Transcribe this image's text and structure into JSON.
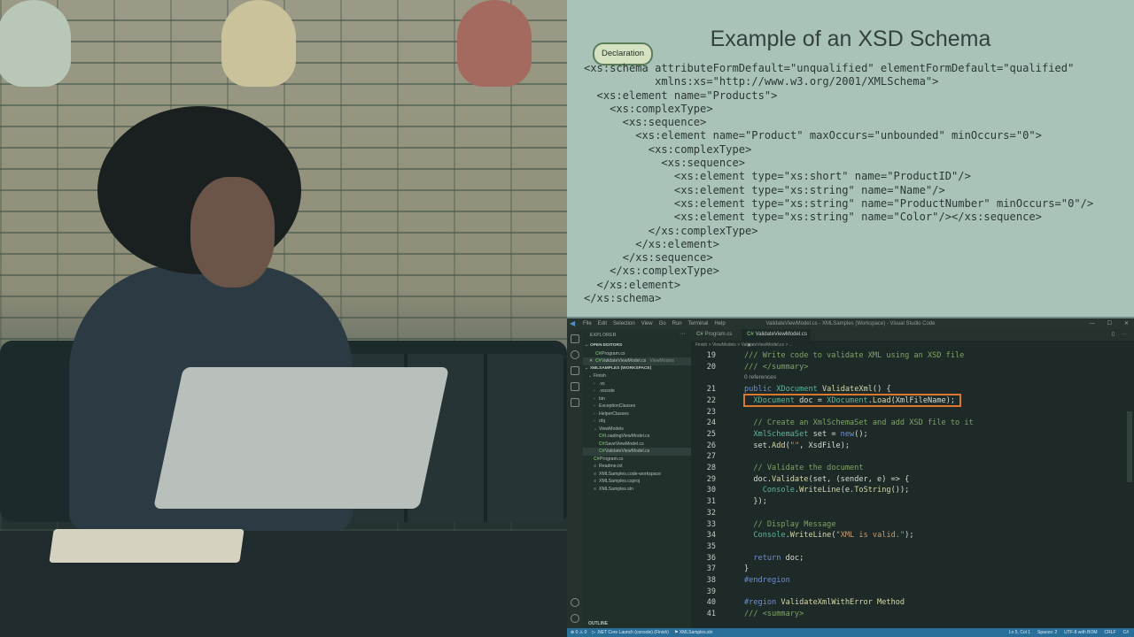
{
  "slide": {
    "title": "Example of an XSD Schema",
    "badge": "Declaration",
    "code": "<xs:schema attributeFormDefault=\"unqualified\" elementFormDefault=\"qualified\"\n           xmlns:xs=\"http://www.w3.org/2001/XMLSchema\">\n  <xs:element name=\"Products\">\n    <xs:complexType>\n      <xs:sequence>\n        <xs:element name=\"Product\" maxOccurs=\"unbounded\" minOccurs=\"0\">\n          <xs:complexType>\n            <xs:sequence>\n              <xs:element type=\"xs:short\" name=\"ProductID\"/>\n              <xs:element type=\"xs:string\" name=\"Name\"/>\n              <xs:element type=\"xs:string\" name=\"ProductNumber\" minOccurs=\"0\"/>\n              <xs:element type=\"xs:string\" name=\"Color\"/></xs:sequence>\n          </xs:complexType>\n        </xs:element>\n      </xs:sequence>\n    </xs:complexType>\n  </xs:element>\n</xs:schema>"
  },
  "vscode": {
    "menu": [
      "File",
      "Edit",
      "Selection",
      "View",
      "Go",
      "Run",
      "Terminal",
      "Help"
    ],
    "window_title": "ValidateViewModel.cs - XMLSamples (Workspace) - Visual Studio Code",
    "explorer_title": "EXPLORER",
    "explorer_more": "···",
    "sidebar": [
      {
        "label": "OPEN EDITORS",
        "kind": "section",
        "indent": 2
      },
      {
        "label": "Program.cs",
        "kind": "cs",
        "indent": 14
      },
      {
        "label": "ValidateViewModel.cs",
        "kind": "cs",
        "indent": 14,
        "hint": "ViewModels",
        "selected": true,
        "close": "✕"
      },
      {
        "label": "XMLSAMPLES (WORKSPACE)",
        "kind": "section",
        "indent": 2
      },
      {
        "label": "Finish",
        "kind": "folder-open",
        "indent": 6
      },
      {
        "label": ".vs",
        "kind": "folder",
        "indent": 12
      },
      {
        "label": ".vscode",
        "kind": "folder",
        "indent": 12
      },
      {
        "label": "bin",
        "kind": "folder",
        "indent": 12
      },
      {
        "label": "ExceptionClasses",
        "kind": "folder",
        "indent": 12
      },
      {
        "label": "HelperClasses",
        "kind": "folder",
        "indent": 12
      },
      {
        "label": "obj",
        "kind": "folder",
        "indent": 12
      },
      {
        "label": "ViewModels",
        "kind": "folder-open",
        "indent": 12
      },
      {
        "label": "LoadingViewModel.cs",
        "kind": "cs",
        "indent": 18
      },
      {
        "label": "SaveViewModel.cs",
        "kind": "cs",
        "indent": 18
      },
      {
        "label": "ValidateViewModel.cs",
        "kind": "cs",
        "indent": 18,
        "selected": true
      },
      {
        "label": "Program.cs",
        "kind": "cs",
        "indent": 12
      },
      {
        "label": "Readme.txt",
        "kind": "file",
        "indent": 12
      },
      {
        "label": "XMLSamples.code-workspace",
        "kind": "file",
        "indent": 12
      },
      {
        "label": "XMLSamples.csproj",
        "kind": "file",
        "indent": 12
      },
      {
        "label": "XMLSamples.sln",
        "kind": "file",
        "indent": 12
      }
    ],
    "outline": "OUTLINE",
    "tabs": {
      "program": "Program.cs",
      "validate": "ValidateViewModel.cs",
      "close": "✕",
      "split": "▯",
      "more": "···"
    },
    "breadcrumb": "Finish  >  ViewModels  >  ValidateViewModel.cs  >  ...",
    "codelens": "0 references",
    "lines": [
      {
        "n": "19",
        "html": "<span class=\"c\">/// Write code to validate XML using an XSD file</span>"
      },
      {
        "n": "20",
        "html": "<span class=\"c\">/// &lt;/summary&gt;</span>"
      },
      {
        "n": "21",
        "html": "<span class=\"k\">public</span> <span class=\"t\">XDocument</span> <span class=\"f\">ValidateXml</span>() {"
      },
      {
        "n": "22",
        "html": "  <span class=\"t\">XDocument</span> doc = <span class=\"t\">XDocument</span>.<span class=\"f\">Load</span>(XmlFileName);"
      },
      {
        "n": "23",
        "html": ""
      },
      {
        "n": "24",
        "html": "  <span class=\"c\">// Create an XmlSchemaSet and add XSD file to it</span>"
      },
      {
        "n": "25",
        "html": "  <span class=\"t\">XmlSchemaSet</span> set = <span class=\"k\">new</span>();"
      },
      {
        "n": "26",
        "html": "  set.<span class=\"f\">Add</span>(<span class=\"s\">\"\"</span>, XsdFile);"
      },
      {
        "n": "27",
        "html": ""
      },
      {
        "n": "28",
        "html": "  <span class=\"c\">// Validate the document</span>"
      },
      {
        "n": "29",
        "html": "  doc.<span class=\"f\">Validate</span>(set, (sender, e) =&gt; {"
      },
      {
        "n": "30",
        "html": "    <span class=\"t\">Console</span>.<span class=\"f\">WriteLine</span>(e.<span class=\"f\">ToString</span>());"
      },
      {
        "n": "31",
        "html": "  });"
      },
      {
        "n": "32",
        "html": ""
      },
      {
        "n": "33",
        "html": "  <span class=\"c\">// Display Message</span>"
      },
      {
        "n": "34",
        "html": "  <span class=\"t\">Console</span>.<span class=\"f\">WriteLine</span>(<span class=\"s\">\"XML is valid.\"</span>);"
      },
      {
        "n": "35",
        "html": ""
      },
      {
        "n": "36",
        "html": "  <span class=\"k\">return</span> doc;"
      },
      {
        "n": "37",
        "html": "}"
      },
      {
        "n": "38",
        "html": "<span class=\"r\">#endregion</span>"
      },
      {
        "n": "39",
        "html": ""
      },
      {
        "n": "40",
        "html": "<span class=\"r\">#region</span> <span class=\"f\">ValidateXmlWithError Method</span>"
      },
      {
        "n": "41",
        "html": "<span class=\"c\">/// &lt;summary&gt;</span>"
      }
    ],
    "status_left": [
      "⊗ 0 ⚠ 0",
      "▷ .NET Core Launch (console) (Finish)",
      "⚑ XMLSamples.sln"
    ],
    "status_right": [
      "Ln 5, Col 1",
      "Spaces: 2",
      "UTF-8 with BOM",
      "CRLF",
      "C#"
    ],
    "win_controls": [
      "—",
      "☐",
      "✕"
    ]
  },
  "colors": {
    "accent_highlight": "#d9782f",
    "statusbar": "#2a6f9a",
    "slide_bg": "#aac3b8"
  }
}
